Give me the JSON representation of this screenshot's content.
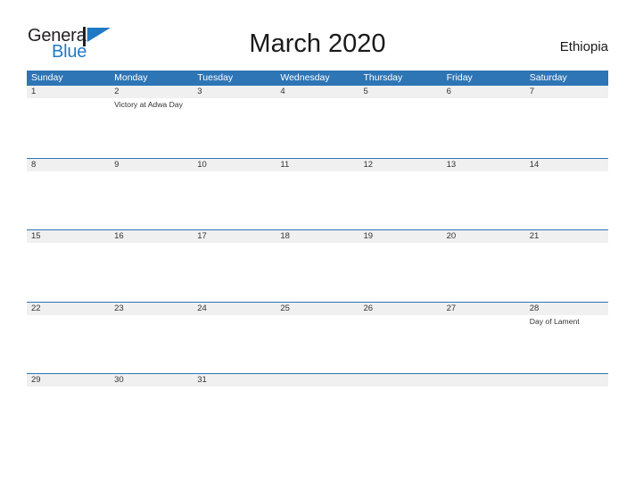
{
  "brand": {
    "name_part1": "General",
    "name_part2": "Blue",
    "flag_icon": "flag-triangle-icon",
    "color_primary": "#2079c4",
    "color_text": "#231f20"
  },
  "header": {
    "title": "March 2020",
    "country": "Ethiopia"
  },
  "theme": {
    "header_blue": "#2e75b6",
    "row_band_gray": "#f0f0f0",
    "rule_blue": "#2e75b6",
    "text_dark": "#333333",
    "page_background": "#ffffff"
  },
  "calendar": {
    "weekdays": [
      "Sunday",
      "Monday",
      "Tuesday",
      "Wednesday",
      "Thursday",
      "Friday",
      "Saturday"
    ],
    "weeks": [
      {
        "days": [
          {
            "number": "1",
            "events": ""
          },
          {
            "number": "2",
            "events": "Victory at Adwa Day"
          },
          {
            "number": "3",
            "events": ""
          },
          {
            "number": "4",
            "events": ""
          },
          {
            "number": "5",
            "events": ""
          },
          {
            "number": "6",
            "events": ""
          },
          {
            "number": "7",
            "events": ""
          }
        ]
      },
      {
        "days": [
          {
            "number": "8",
            "events": ""
          },
          {
            "number": "9",
            "events": ""
          },
          {
            "number": "10",
            "events": ""
          },
          {
            "number": "11",
            "events": ""
          },
          {
            "number": "12",
            "events": ""
          },
          {
            "number": "13",
            "events": ""
          },
          {
            "number": "14",
            "events": ""
          }
        ]
      },
      {
        "days": [
          {
            "number": "15",
            "events": ""
          },
          {
            "number": "16",
            "events": ""
          },
          {
            "number": "17",
            "events": ""
          },
          {
            "number": "18",
            "events": ""
          },
          {
            "number": "19",
            "events": ""
          },
          {
            "number": "20",
            "events": ""
          },
          {
            "number": "21",
            "events": ""
          }
        ]
      },
      {
        "days": [
          {
            "number": "22",
            "events": ""
          },
          {
            "number": "23",
            "events": ""
          },
          {
            "number": "24",
            "events": ""
          },
          {
            "number": "25",
            "events": ""
          },
          {
            "number": "26",
            "events": ""
          },
          {
            "number": "27",
            "events": ""
          },
          {
            "number": "28",
            "events": "Day of Lament"
          }
        ]
      },
      {
        "days": [
          {
            "number": "29",
            "events": ""
          },
          {
            "number": "30",
            "events": ""
          },
          {
            "number": "31",
            "events": ""
          },
          {
            "number": "",
            "events": ""
          },
          {
            "number": "",
            "events": ""
          },
          {
            "number": "",
            "events": ""
          },
          {
            "number": "",
            "events": ""
          }
        ]
      }
    ]
  }
}
